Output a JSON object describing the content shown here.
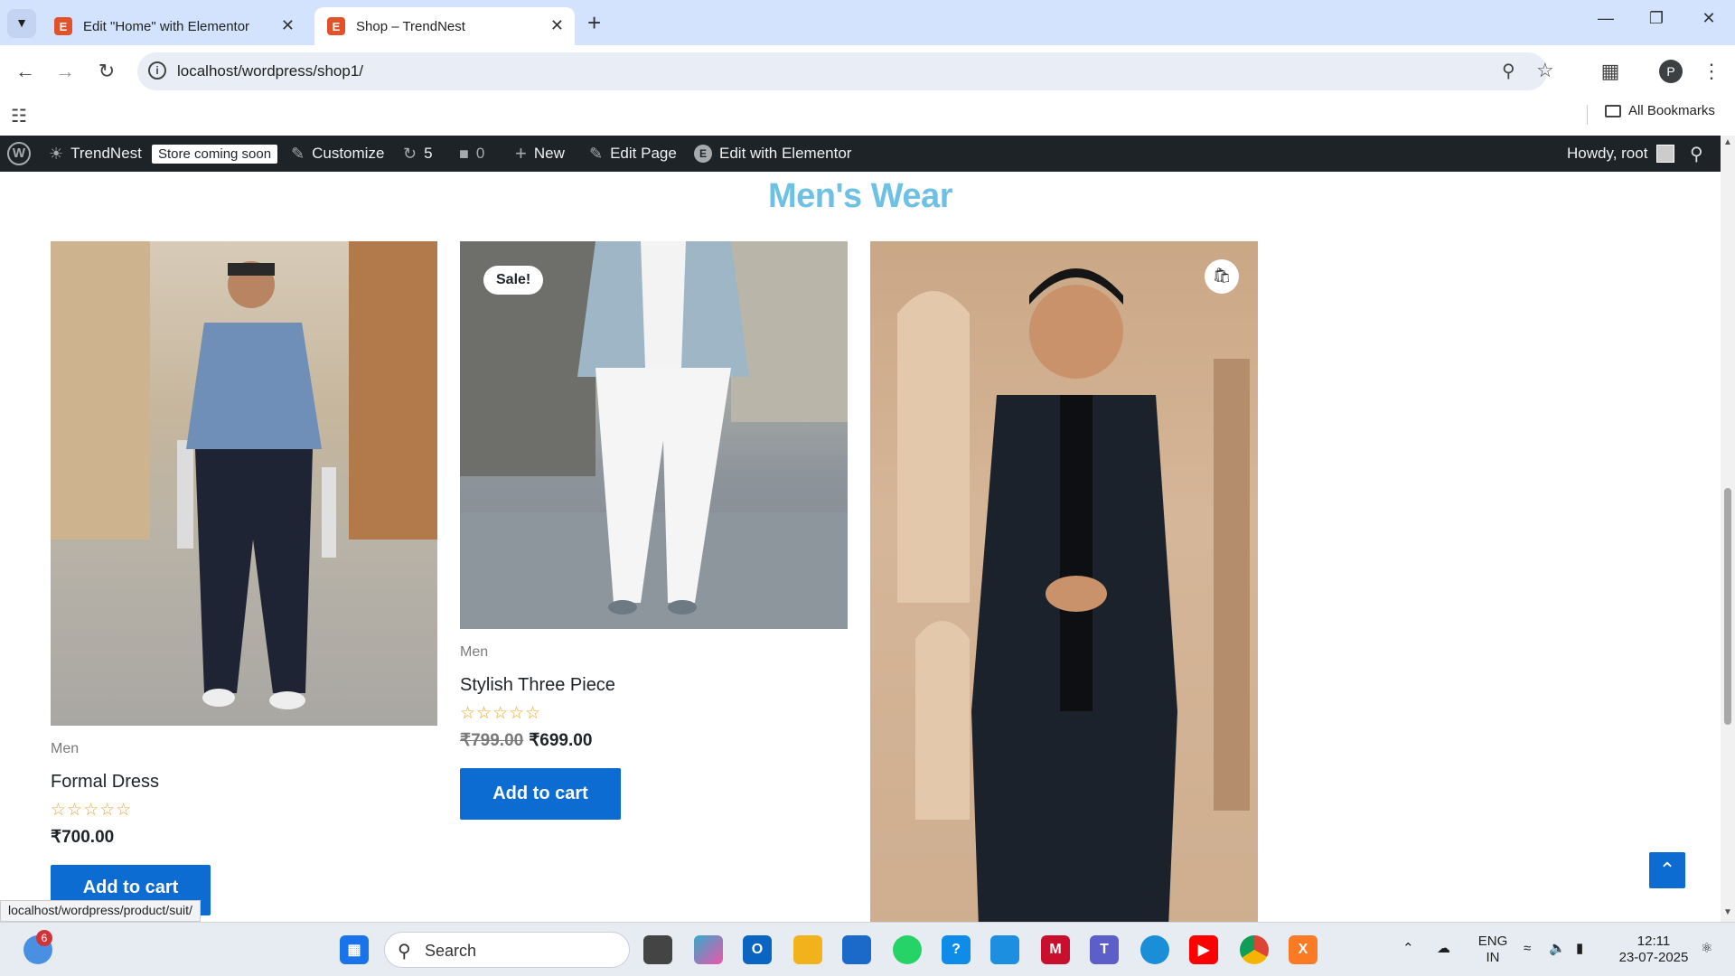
{
  "browser": {
    "tabs": [
      {
        "title": "Edit \"Home\" with Elementor",
        "active": false
      },
      {
        "title": "Shop – TrendNest",
        "active": true
      }
    ],
    "url": "localhost/wordpress/shop1/",
    "bookmarks_label": "All Bookmarks",
    "profile_initial": "P"
  },
  "adminbar": {
    "site_name": "TrendNest",
    "store_badge": "Store coming soon",
    "customize": "Customize",
    "updates_count": "5",
    "comments_count": "0",
    "new_label": "New",
    "edit_page": "Edit Page",
    "edit_elementor": "Edit with Elementor",
    "howdy": "Howdy, root"
  },
  "section": {
    "heading": "Men's Wear"
  },
  "products": [
    {
      "category": "Men",
      "name": "Formal Dress",
      "price": "₹700.00",
      "old_price": "",
      "sale": "",
      "rating_stars": "☆☆☆☆☆",
      "button": "Add to cart"
    },
    {
      "category": "Men",
      "name": "Stylish Three Piece",
      "price": "₹699.00",
      "old_price": "₹799.00",
      "sale": "Sale!",
      "rating_stars": "☆☆☆☆☆",
      "button": "Add to cart"
    }
  ],
  "status_url": "localhost/wordpress/product/suit/",
  "taskbar": {
    "search_placeholder": "Search",
    "notification_count": "6",
    "lang_top": "ENG",
    "lang_bottom": "IN",
    "time": "12:11",
    "date": "23-07-2025"
  }
}
